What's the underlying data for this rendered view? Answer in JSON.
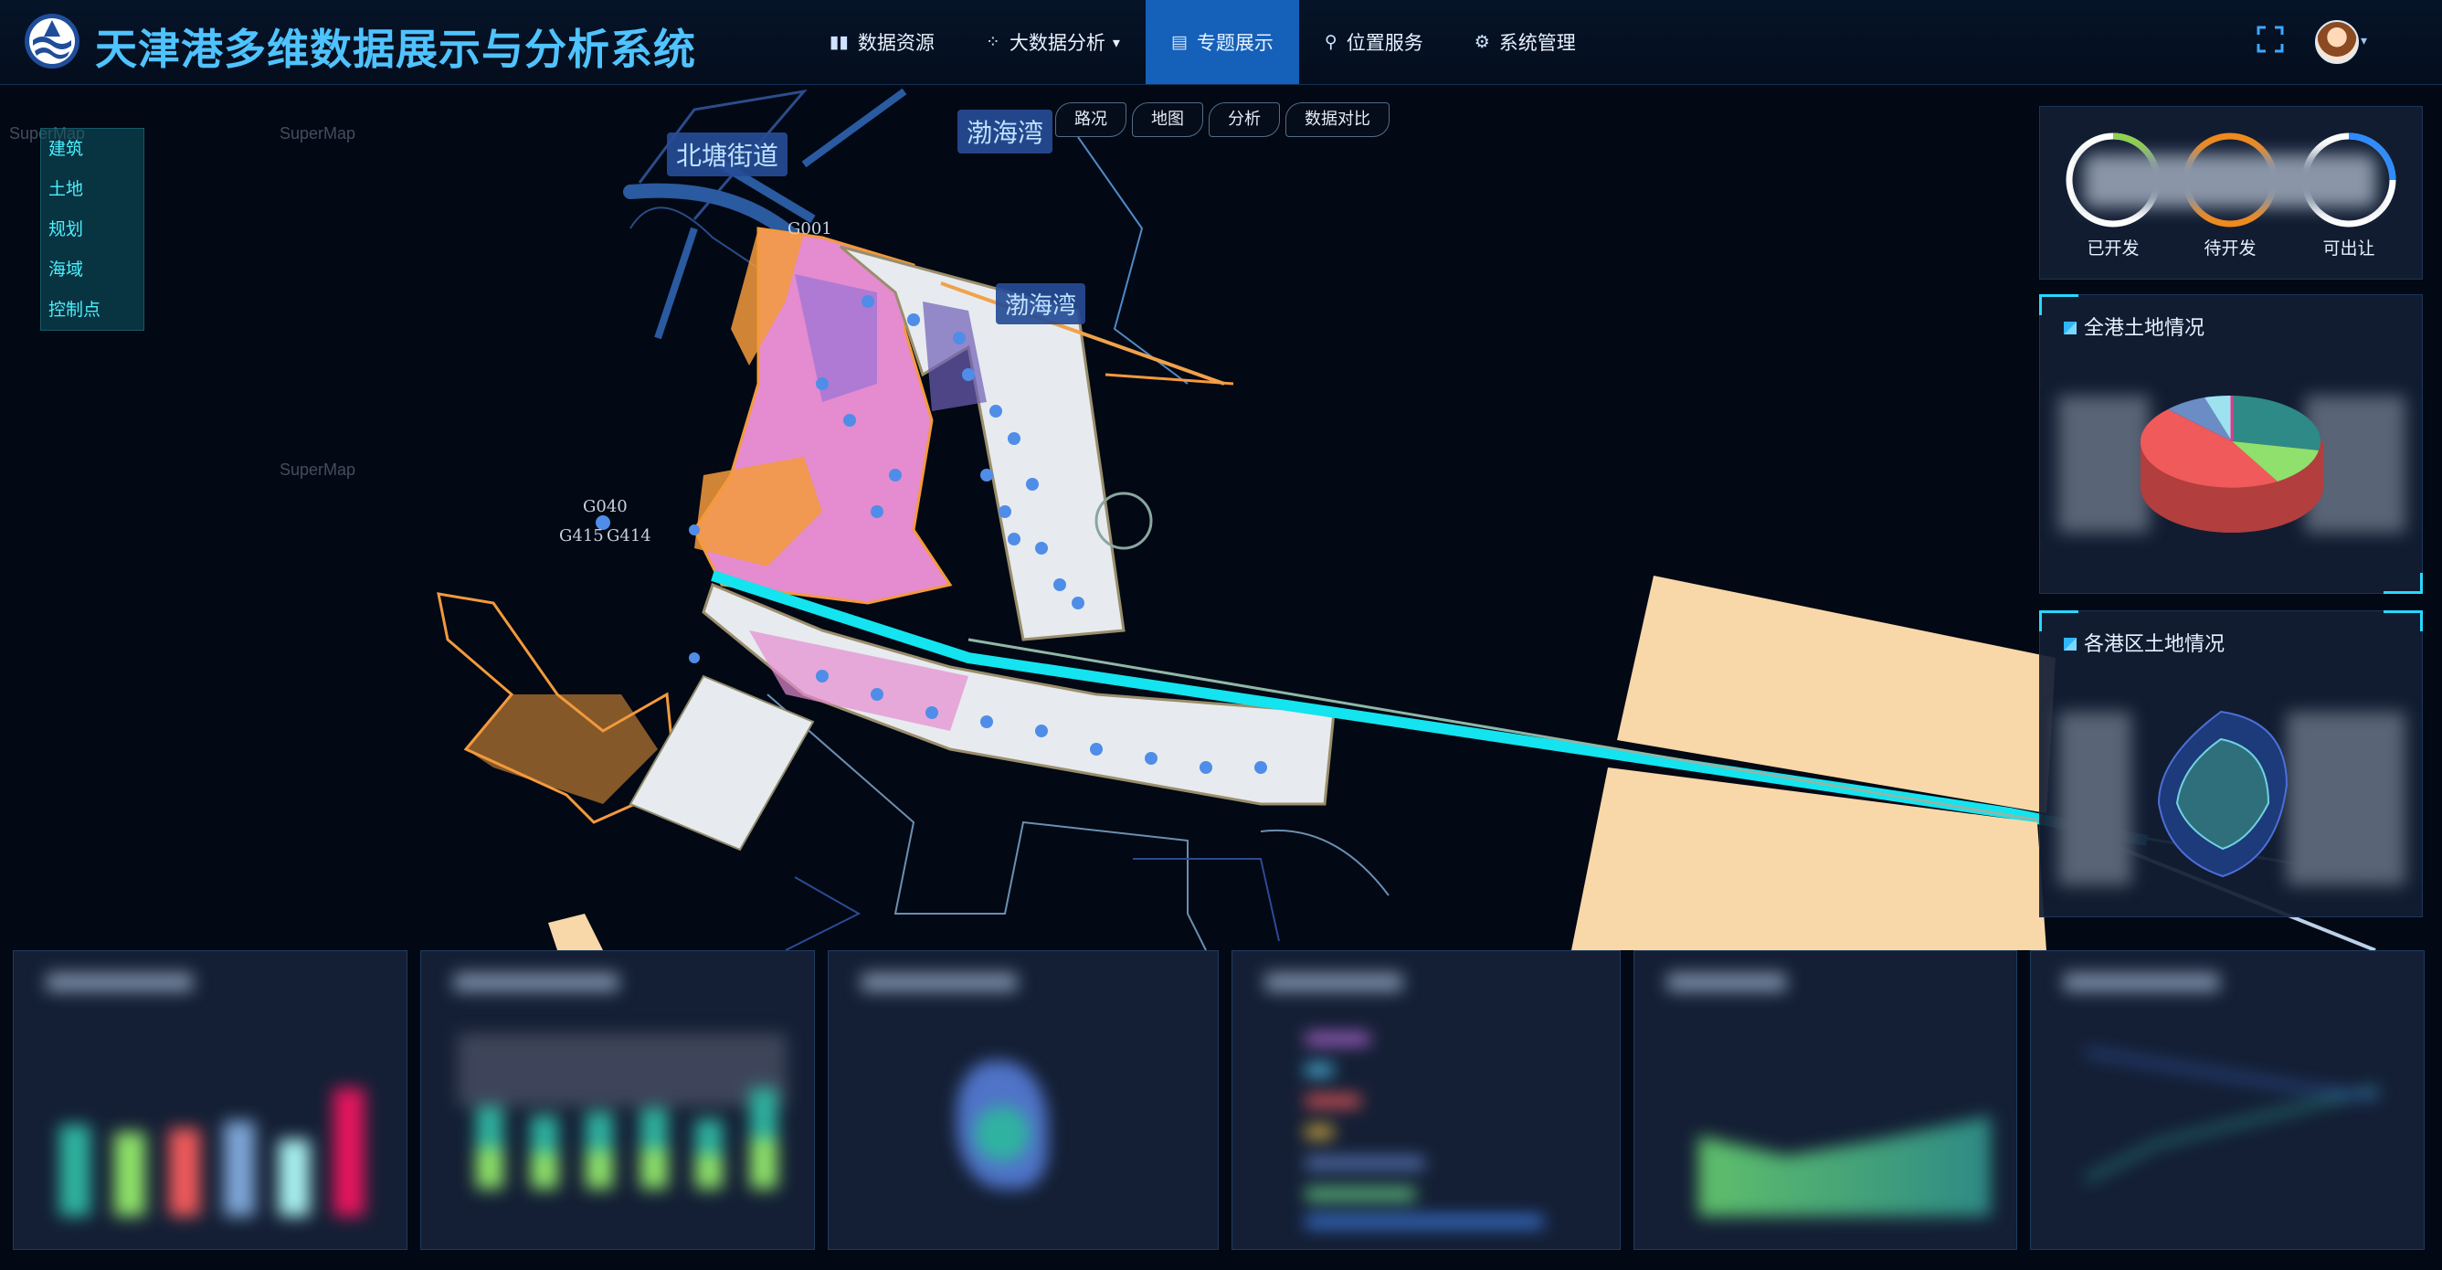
{
  "header": {
    "title": "天津港多维数据展示与分析系统",
    "nav": [
      {
        "label": "数据资源",
        "icon": "bar-chart-icon"
      },
      {
        "label": "大数据分析",
        "icon": "network-icon",
        "has_dropdown": true
      },
      {
        "label": "专题展示",
        "icon": "document-icon",
        "active": true
      },
      {
        "label": "位置服务",
        "icon": "location-pin-icon"
      },
      {
        "label": "系统管理",
        "icon": "gear-icon"
      }
    ]
  },
  "map": {
    "place_labels": [
      "北塘街道",
      "渤海湾",
      "渤海湾"
    ],
    "watermark": "SuperMap",
    "codes": [
      "G040",
      "G415",
      "G414",
      "G001"
    ],
    "tabs": [
      "路况",
      "地图",
      "分析",
      "数据对比"
    ]
  },
  "layers": [
    "建筑",
    "土地",
    "规划",
    "海域",
    "控制点"
  ],
  "right_panels": {
    "rings": [
      {
        "label": "已开发",
        "color": "#8fd14f"
      },
      {
        "label": "待开发",
        "color": "#f08a1c"
      },
      {
        "label": "可出让",
        "color": "#2c8cff"
      }
    ],
    "land_overview_title": "全港土地情况",
    "district_land_title": "各港区土地情况"
  },
  "colors": {
    "accent": "#27d8ff",
    "title": "#4fc3ff",
    "nav_active": "#1560b8",
    "land_pink": "#e58bd0",
    "land_orange": "#f39a3c",
    "reclaim": "#f8d7a8"
  }
}
